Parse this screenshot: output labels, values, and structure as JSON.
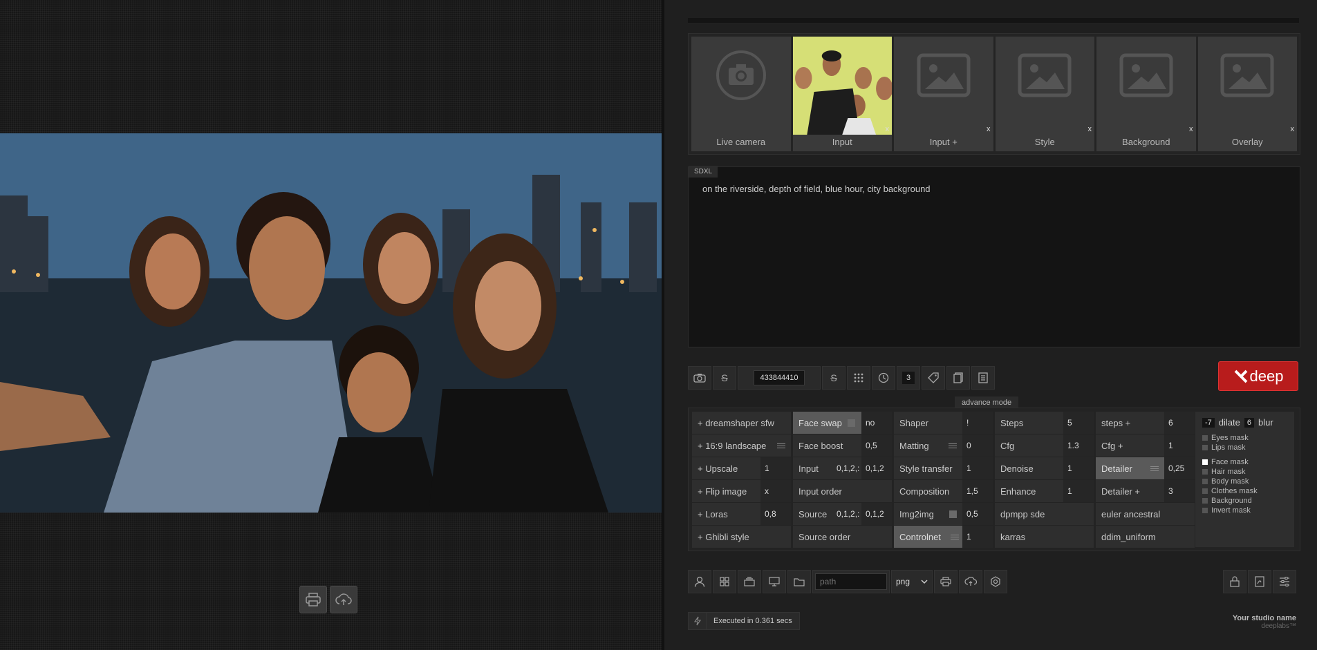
{
  "slots": [
    {
      "label": "Live camera",
      "icon": "camera-icon",
      "close": ""
    },
    {
      "label": "Input",
      "icon": "thumbnail",
      "close": "x"
    },
    {
      "label": "Input +",
      "icon": "image-icon",
      "close": "x"
    },
    {
      "label": "Style",
      "icon": "image-icon",
      "close": "x"
    },
    {
      "label": "Background",
      "icon": "image-icon",
      "close": "x"
    },
    {
      "label": "Overlay",
      "icon": "image-icon",
      "close": "x"
    }
  ],
  "prompt": {
    "tag": "SDXL",
    "text": "on the riverside, depth of field, blue hour, city background"
  },
  "toolbar": {
    "seed": "433844410",
    "count": "3"
  },
  "deep_button": {
    "label": "deep",
    "color": "#b81c1c"
  },
  "advance_label": "advance mode",
  "grid": {
    "col1": [
      {
        "label": "+  dreamshaper sfw"
      },
      {
        "label": "+  16:9 landscape"
      },
      {
        "label": "+  Upscale",
        "value": "1"
      },
      {
        "label": "+  Flip image",
        "value": "x"
      },
      {
        "label": "+  Loras",
        "value": "0,8"
      },
      {
        "label": "+  Ghibli style"
      }
    ],
    "col2": [
      {
        "label": "Face swap",
        "value": "no"
      },
      {
        "label": "Face boost",
        "value": "0,5"
      },
      {
        "label": "Input",
        "a": "0,1,2,:",
        "b": "0,1,2"
      },
      {
        "label": "Input order"
      },
      {
        "label": "Source",
        "a": "0,1,2,:",
        "b": "0,1,2"
      },
      {
        "label": "Source order"
      }
    ],
    "col3": [
      {
        "label": "Shaper",
        "value": "!"
      },
      {
        "label": "Matting",
        "value": "0"
      },
      {
        "label": "Style transfer",
        "value": "1"
      },
      {
        "label": "Composition",
        "value": "1,5"
      },
      {
        "label": "Img2img",
        "value": "0,5"
      },
      {
        "label": "Controlnet",
        "value": "1"
      }
    ],
    "col4": [
      {
        "label": "Steps",
        "value": "5"
      },
      {
        "label": "Cfg",
        "value": "1.3"
      },
      {
        "label": "Denoise",
        "value": "1"
      },
      {
        "label": "Enhance",
        "value": "1"
      },
      {
        "label": "dpmpp sde"
      },
      {
        "label": "karras"
      }
    ],
    "col5": [
      {
        "label": "steps +",
        "value": "6"
      },
      {
        "label": "Cfg +",
        "value": "1"
      },
      {
        "label": "Detailer",
        "value": "0,25"
      },
      {
        "label": "Detailer +",
        "value": "3"
      },
      {
        "label": "euler ancestral"
      },
      {
        "label": "ddim_uniform"
      }
    ],
    "masks": {
      "dilate_value": "-7",
      "dilate_label": "dilate",
      "blur_value": "6",
      "blur_label": "blur",
      "items": [
        "Eyes mask",
        "Lips mask",
        "Face mask",
        "Hair mask",
        "Body mask",
        "Clothes mask",
        "Background",
        "Invert mask"
      ]
    }
  },
  "bottom": {
    "path_placeholder": "path",
    "format": "png"
  },
  "status": "Executed in 0.361 secs",
  "studio": {
    "name": "Your studio name",
    "brand": "deeplabs™"
  }
}
